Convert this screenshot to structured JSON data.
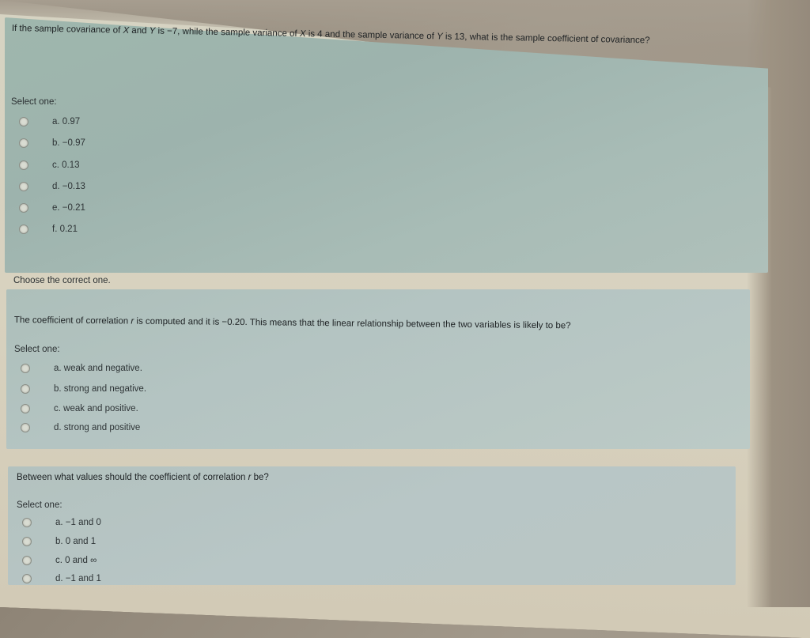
{
  "questions": [
    {
      "text_parts": [
        "If the sample covariance of ",
        "X",
        " and ",
        "Y",
        " is −7, while the sample variance of ",
        "X",
        " is 4 and the sample variance of ",
        "Y",
        " is 13, what is the sample coefficient of covariance?"
      ],
      "select_label": "Select one:",
      "options": [
        {
          "letter": "a.",
          "label": "0.97"
        },
        {
          "letter": "b.",
          "label": "−0.97"
        },
        {
          "letter": "c.",
          "label": "0.13"
        },
        {
          "letter": "d.",
          "label": "−0.13"
        },
        {
          "letter": "e.",
          "label": "−0.21"
        },
        {
          "letter": "f.",
          "label": "0.21"
        }
      ]
    },
    {
      "prompt": "Choose the correct one.",
      "text_parts": [
        "The coefficient of correlation ",
        "r",
        " is computed and it is −0.20.  This means that the linear relationship between the two variables is likely to be?"
      ],
      "select_label": "Select one:",
      "options": [
        {
          "letter": "a.",
          "label": "weak and negative."
        },
        {
          "letter": "b.",
          "label": "strong and negative."
        },
        {
          "letter": "c.",
          "label": "weak and positive."
        },
        {
          "letter": "d.",
          "label": "strong and positive"
        }
      ]
    },
    {
      "text_parts": [
        "Between what values should the coefficient of correlation ",
        "r",
        " be?"
      ],
      "select_label": "Select one:",
      "options": [
        {
          "letter": "a.",
          "label": "−1 and 0"
        },
        {
          "letter": "b.",
          "label": "0 and 1"
        },
        {
          "letter": "c.",
          "label": "0 and ∞"
        },
        {
          "letter": "d.",
          "label": "−1 and 1"
        }
      ]
    }
  ]
}
